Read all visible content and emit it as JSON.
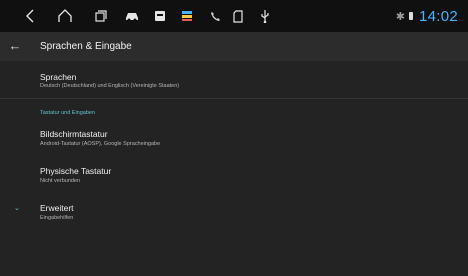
{
  "statusbar": {
    "icons": [
      "back-icon",
      "home-icon",
      "recents-icon",
      "car-icon",
      "media-icon",
      "apps-icon",
      "phone-icon",
      "sd-card-icon",
      "usb-icon"
    ],
    "bluetooth": "✱",
    "time": "14:02",
    "accent": "#3fb6ff"
  },
  "appbar": {
    "back": "←",
    "title": "Sprachen & Eingabe"
  },
  "items": [
    {
      "title": "Sprachen",
      "subtitle": "Deutsch (Deutschland) und Englisch (Vereinigte Staaten)"
    },
    {
      "title": "Bildschirmtastatur",
      "subtitle": "Android-Tastatur (AOSP), Google Spracheingabe"
    },
    {
      "title": "Physische Tastatur",
      "subtitle": "Nicht verbunden"
    },
    {
      "title": "Erweitert",
      "subtitle": "Eingabehilfen"
    }
  ],
  "section_header": "Tastatur und Eingaben",
  "expand_icon": "⌄",
  "accent_teal": "#5ec5d2"
}
